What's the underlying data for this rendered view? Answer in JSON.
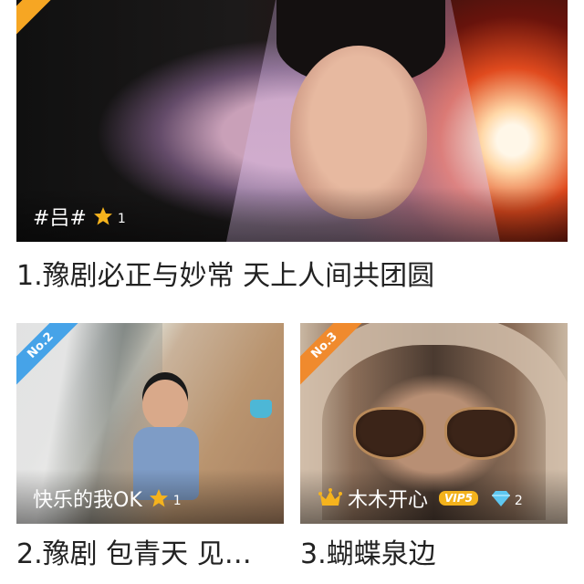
{
  "cards": [
    {
      "rank": "",
      "caption": "#吕#",
      "stars": "1",
      "title": "1.豫剧必正与妙常 天上人间共团圆"
    },
    {
      "rank": "No.2",
      "caption": "快乐的我OK",
      "stars": "1",
      "title": "2.豫剧 包青天 见…"
    },
    {
      "rank": "No.3",
      "caption": "木木开心",
      "vip": "VIP5",
      "diamonds": "2",
      "title": "3.蝴蝶泉边"
    }
  ],
  "colors": {
    "rank_1": "#f6a623",
    "rank_2": "#46a3e8",
    "rank_3": "#f08a2d",
    "star": "#f5b31d",
    "diamond": "#5ec7f0"
  }
}
